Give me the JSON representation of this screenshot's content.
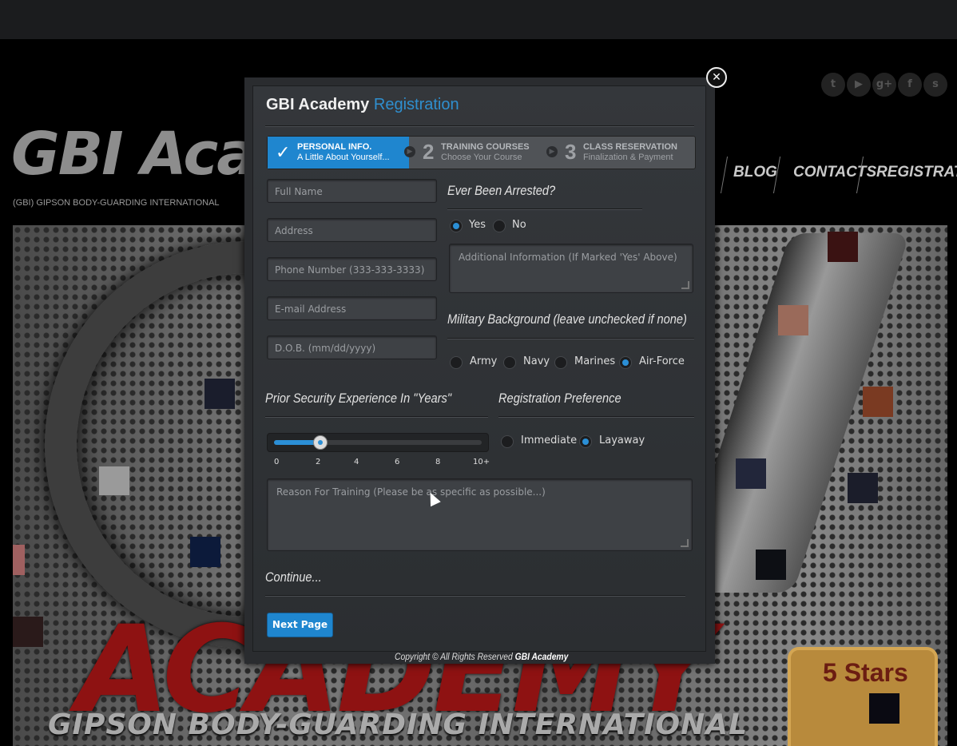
{
  "site": {
    "title": "GBI Acad",
    "tagline": "(GBI) GIPSON BODY-GUARDING INTERNATIONAL",
    "social": [
      "twitter-icon",
      "youtube-icon",
      "google-plus-icon",
      "facebook-icon",
      "skype-icon"
    ],
    "nav": [
      "BLOG",
      "CONTACTS",
      "REGISTRATION"
    ],
    "hero_word": "ACADEMY",
    "hero_sub": "GIPSON BODY-GUARDING INTERNATIONAL",
    "badge": "5 Stars"
  },
  "modal": {
    "title": "GBI Academy",
    "title_accent": "Registration",
    "steps": [
      {
        "num": "",
        "line1": "PERSONAL INFO.",
        "line2": "A Little About Yourself...",
        "active": true
      },
      {
        "num": "2",
        "line1": "TRAINING COURSES",
        "line2": "Choose Your Course",
        "active": false
      },
      {
        "num": "3",
        "line1": "CLASS RESERVATION",
        "line2": "Finalization & Payment",
        "active": false
      }
    ],
    "fields": [
      {
        "placeholder": "Full Name"
      },
      {
        "placeholder": "Address"
      },
      {
        "placeholder": "Phone Number (333-333-3333)"
      },
      {
        "placeholder": "E-mail Address"
      },
      {
        "placeholder": "D.O.B. (mm/dd/yyyy)"
      }
    ],
    "arrested": {
      "heading": "Ever Been Arrested?",
      "options": [
        "Yes",
        "No"
      ],
      "selected": "Yes",
      "info_placeholder": "Additional Information (If Marked 'Yes' Above)"
    },
    "military": {
      "heading": "Military Background (leave unchecked if none)",
      "options": [
        "Army",
        "Navy",
        "Marines",
        "Air-Force"
      ],
      "selected": "Air-Force"
    },
    "experience": {
      "heading": "Prior Security Experience In \"Years\"",
      "ticks": [
        "0",
        "2",
        "4",
        "6",
        "8",
        "10+"
      ],
      "value": 2
    },
    "preference": {
      "heading": "Registration Preference",
      "options": [
        "Immediate",
        "Layaway"
      ],
      "selected": "Layaway"
    },
    "reason_placeholder": "Reason For Training (Please be as specific as possible...)",
    "continue_heading": "Continue...",
    "next_button": "Next Page",
    "copyright": "Copyright © All Rights Reserved",
    "copyright_brand": "GBI Academy",
    "colors": {
      "accent": "#1f86cf",
      "panel": "#2a2c2f"
    }
  }
}
